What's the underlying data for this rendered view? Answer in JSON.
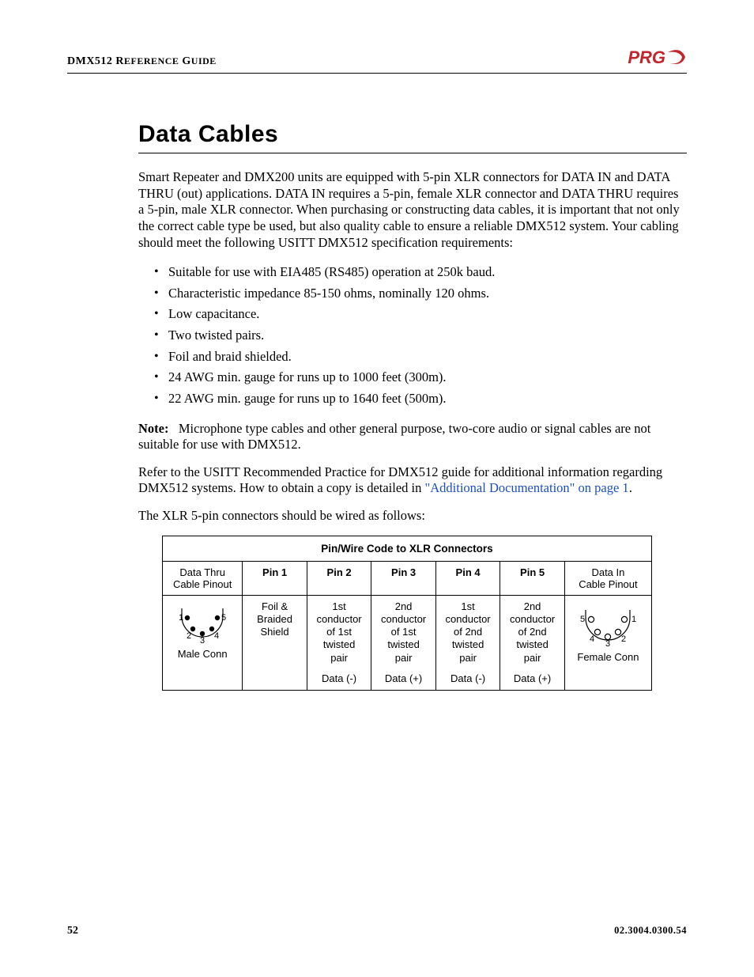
{
  "header": {
    "guide_title": "DMX512 REFERENCE GUIDE",
    "logo_text": "PRG"
  },
  "section": {
    "title": "Data Cables",
    "intro": "Smart Repeater and DMX200 units are equipped with 5-pin XLR connectors for DATA IN and DATA THRU (out) applications. DATA IN requires a 5-pin, female XLR connector and DATA THRU requires a 5-pin, male XLR connector. When purchasing or constructing data cables, it is important that not only the correct cable type be used, but also quality cable to ensure a reliable DMX512 system. Your cabling should meet the following USITT DMX512 specification requirements:",
    "bullets": [
      "Suitable for use with EIA485 (RS485) operation at 250k baud.",
      "Characteristic impedance 85-150 ohms, nominally 120 ohms.",
      "Low capacitance.",
      "Two twisted pairs.",
      "Foil and braid shielded.",
      "24 AWG min. gauge for runs up to 1000 feet (300m).",
      "22 AWG min. gauge for runs up to 1640 feet (500m)."
    ],
    "note_label": "Note:",
    "note_text": "Microphone type cables and other general purpose, two-core audio or signal cables are not suitable for use with DMX512.",
    "refer_pre": "Refer to the USITT Recommended Practice for DMX512 guide for additional information regarding DMX512 systems. How to obtain a copy is detailed in ",
    "refer_link": "\"Additional Documentation\" on page 1",
    "refer_post": ".",
    "wiring_intro": "The XLR 5-pin connectors should be wired as follows:"
  },
  "table": {
    "title": "Pin/Wire Code to XLR Connectors",
    "left_header_l1": "Data Thru",
    "left_header_l2": "Cable Pinout",
    "right_header_l1": "Data In",
    "right_header_l2": "Cable Pinout",
    "pins": [
      "Pin 1",
      "Pin 2",
      "Pin 3",
      "Pin 4",
      "Pin 5"
    ],
    "cells": [
      "Foil &\nBraided\nShield",
      "1st\nconductor\nof 1st\ntwisted\npair",
      "2nd\nconductor\nof 1st\ntwisted\npair",
      "1st\nconductor\nof 2nd\ntwisted\npair",
      "2nd\nconductor\nof 2nd\ntwisted\npair"
    ],
    "signs": [
      "",
      "Data (-)",
      "Data (+)",
      "Data (-)",
      "Data (+)"
    ],
    "male_label": "Male Conn",
    "female_label": "Female Conn",
    "male_pins": {
      "1": "1",
      "2": "2",
      "3": "3",
      "4": "4",
      "5": "5"
    },
    "female_pins": {
      "1": "1",
      "2": "2",
      "3": "3",
      "4": "4",
      "5": "5"
    }
  },
  "footer": {
    "page": "52",
    "doc": "02.3004.0300.54"
  }
}
